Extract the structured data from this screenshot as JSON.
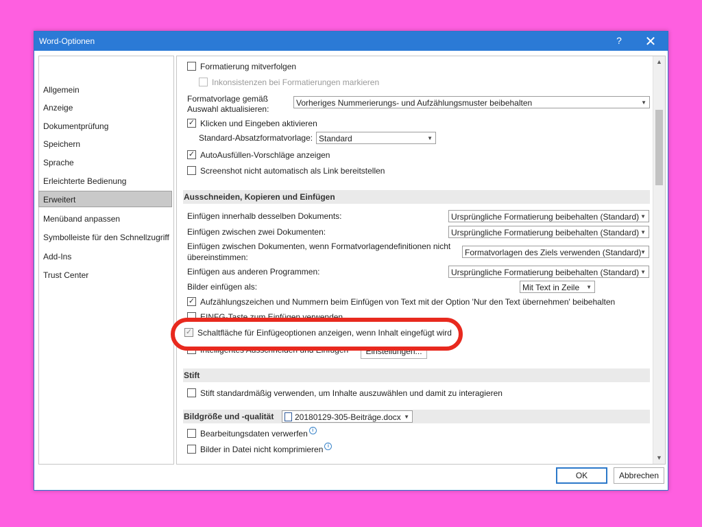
{
  "window": {
    "title": "Word-Optionen",
    "help": "?",
    "close": "✕"
  },
  "nav": [
    "Allgemein",
    "Anzeige",
    "Dokumentprüfung",
    "Speichern",
    "Sprache",
    "Erleichterte Bedienung",
    "Erweitert",
    "Menüband anpassen",
    "Symbolleiste für den Schnellzugriff",
    "Add-Ins",
    "Trust Center"
  ],
  "edit": {
    "track_formatting": "Formatierung mitverfolgen",
    "mark_inconsistencies": "Inkonsistenzen bei Formatierungen markieren",
    "style_update_label_1": "Formatvorlage gemäß",
    "style_update_label_2": "Auswahl aktualisieren:",
    "style_update_value": "Vorheriges Nummerierungs- und Aufzählungsmuster beibehalten",
    "click_and_type": "Klicken und Eingeben aktivieren",
    "default_para_label": "Standard-Absatzformatvorlage:",
    "default_para_value": "Standard",
    "autocomplete": "AutoAusfüllen-Vorschläge anzeigen",
    "screenshot_link": "Screenshot nicht automatisch als Link bereitstellen"
  },
  "cut_copy_paste": {
    "header": "Ausschneiden, Kopieren und Einfügen",
    "within_doc_label": "Einfügen innerhalb desselben Dokuments:",
    "within_doc_value": "Ursprüngliche Formatierung beibehalten (Standard)",
    "between_docs_label": "Einfügen zwischen zwei Dokumenten:",
    "between_docs_value": "Ursprüngliche Formatierung beibehalten (Standard)",
    "conflict_label_1": "Einfügen zwischen Dokumenten, wenn Formatvorlagendefinitionen nicht",
    "conflict_label_2": "übereinstimmen:",
    "conflict_value": "Formatvorlagen des Ziels verwenden (Standard)",
    "other_programs_label": "Einfügen aus anderen Programmen:",
    "other_programs_value": "Ursprüngliche Formatierung beibehalten (Standard)",
    "pictures_label": "Bilder einfügen als:",
    "pictures_value": "Mit Text in Zeile",
    "bullets_keep": "Aufzählungszeichen und Nummern beim Einfügen von Text mit der Option 'Nur den Text übernehmen' beibehalten",
    "use_insert_key": "EINFG-Taste zum Einfügen verwenden",
    "paste_options_button": "Schaltfläche für Einfügeoptionen anzeigen, wenn Inhalt eingefügt wird",
    "smart_cut": "Intelligentes Ausschneiden und Einfügen",
    "settings_button": "Einstellungen..."
  },
  "pen": {
    "header": "Stift",
    "default_select": "Stift standardmäßig verwenden, um Inhalte auszuwählen und damit zu interagieren"
  },
  "image": {
    "header": "Bildgröße und -qualität",
    "file_value": "20180129-305-Beiträge.docx",
    "discard_edit": "Bearbeitungsdaten verwerfen",
    "no_compress": "Bilder in Datei nicht komprimieren"
  },
  "footer": {
    "ok": "OK",
    "cancel": "Abbrechen"
  },
  "colors": {
    "accent": "#2b7ad6",
    "highlight": "#e8291e",
    "background": "#fe5fe0"
  }
}
